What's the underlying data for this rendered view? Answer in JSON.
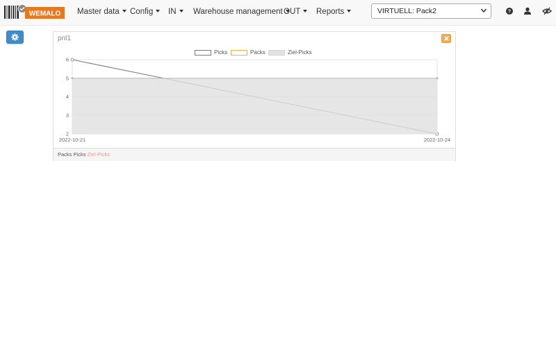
{
  "app": {
    "brand": "WEMALO",
    "brand_color": "#e37a22"
  },
  "nav": {
    "items": [
      {
        "label": "Master data"
      },
      {
        "label": "Config"
      },
      {
        "label": "IN"
      },
      {
        "label": "Warehouse management"
      },
      {
        "label": "OUT"
      },
      {
        "label": "Reports"
      }
    ],
    "store_select": {
      "value": "VIRTUELL: Pack2"
    },
    "icons": [
      "help-icon",
      "user-icon",
      "hide-icon"
    ]
  },
  "toolbar": {
    "settings_icon": "gear-icon",
    "accent": "#428bca"
  },
  "panel": {
    "title": "pnl1",
    "close_icon": "close-icon",
    "footer": {
      "packs": "Packs",
      "picks": "Picks",
      "ziel": "Ziel-Picks"
    }
  },
  "chart_data": {
    "type": "line",
    "x": [
      "2022-10-21",
      "2022-10-24"
    ],
    "ylim": [
      2,
      6
    ],
    "yticks": [
      2,
      3,
      4,
      5,
      6
    ],
    "legend_position": "top-center",
    "grid": true,
    "series": [
      {
        "name": "Picks",
        "values": [
          6,
          2
        ],
        "color": "#777777"
      },
      {
        "name": "Packs",
        "values": [],
        "color": "#f0ad4e"
      },
      {
        "name": "Ziel-Picks",
        "values": [
          5,
          5
        ],
        "color": "#bbbbbb",
        "fill": true
      }
    ]
  }
}
